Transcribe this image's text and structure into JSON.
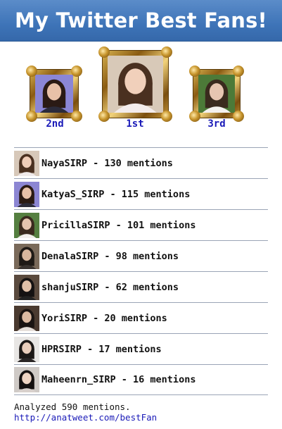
{
  "header": {
    "title": "My Twitter Best Fans!"
  },
  "podium": [
    {
      "rank": "2nd",
      "bg": "#8b86d6",
      "hair": "#2a1a14",
      "skin": "#e8c1a8",
      "cloth": "#2b2b3a"
    },
    {
      "rank": "1st",
      "bg": "#d8c9b8",
      "hair": "#4a3020",
      "skin": "#f1d0bb",
      "cloth": "#f3ecec"
    },
    {
      "rank": "3rd",
      "bg": "#4c7a38",
      "hair": "#3a2a1e",
      "skin": "#e6c5b1",
      "cloth": "#f4f1ee"
    }
  ],
  "fans": [
    {
      "text": "NayaSIRP - 130 mentions",
      "bg": "#d7c8b9",
      "hair": "#4a3020",
      "skin": "#efcdb8",
      "cloth": "#f0eaea"
    },
    {
      "text": "KatyaS_SIRP - 115 mentions",
      "bg": "#8c86d3",
      "hair": "#2a1a14",
      "skin": "#e7c1a9",
      "cloth": "#2b2b3a"
    },
    {
      "text": "PricillaSIRP - 101 mentions",
      "bg": "#557f40",
      "hair": "#3a2a1e",
      "skin": "#e4c4af",
      "cloth": "#f2efec"
    },
    {
      "text": "DenalaSIRP - 98 mentions",
      "bg": "#7a6a5a",
      "hair": "#1f1a16",
      "skin": "#d9b79e",
      "cloth": "#3a3430"
    },
    {
      "text": "shanjuSIRP - 62 mentions",
      "bg": "#5a4a3e",
      "hair": "#151212",
      "skin": "#e0c0a8",
      "cloth": "#222222"
    },
    {
      "text": "YoriSIRP - 20 mentions",
      "bg": "#4a3a30",
      "hair": "#1a1412",
      "skin": "#dcbaa2",
      "cloth": "#e6dfda"
    },
    {
      "text": "HPRSIRP - 17 mentions",
      "bg": "#e8e6e4",
      "hair": "#1c1816",
      "skin": "#e9cdbb",
      "cloth": "#2a2626"
    },
    {
      "text": "Maheenrn_SIRP - 16 mentions",
      "bg": "#cfcac6",
      "hair": "#141010",
      "skin": "#edd3c2",
      "cloth": "#d8d0cc"
    }
  ],
  "footer": {
    "summary": "Analyzed 590 mentions.",
    "link": "http://anatweet.com/bestFan"
  }
}
